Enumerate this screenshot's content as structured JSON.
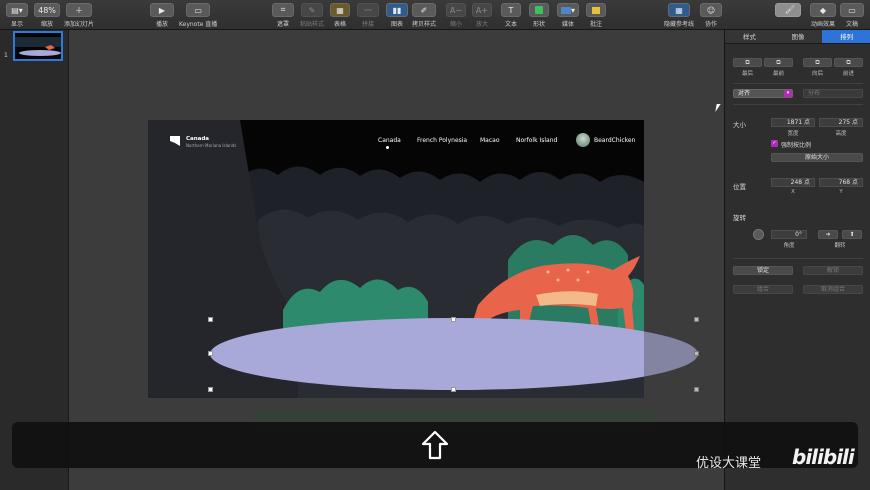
{
  "toolbar": {
    "view": {
      "label": "显示"
    },
    "zoom": {
      "label": "缩放",
      "value": "48%"
    },
    "add_slide": {
      "label": "添加幻灯片"
    },
    "play": {
      "label": "播放"
    },
    "keynote_live": {
      "label": "Keynote 直播"
    },
    "mask": {
      "label": "遮罩"
    },
    "cursor_style": {
      "label": "粘贴样式"
    },
    "table": {
      "label": "表格"
    },
    "chart_like": {
      "label": "拼接"
    },
    "chart": {
      "label": "图表"
    },
    "copy_style": {
      "label": "拷贝样式"
    },
    "shrink": {
      "label": "缩小"
    },
    "enlarge": {
      "label": "放大"
    },
    "text": {
      "label": "文本"
    },
    "shape": {
      "label": "形状"
    },
    "media": {
      "label": "媒体"
    },
    "comment": {
      "label": "批注"
    },
    "guides": {
      "label": "隐藏参考线"
    },
    "collaborate": {
      "label": "协作"
    },
    "format": {
      "label": "格式"
    },
    "animate": {
      "label": "动画效果"
    },
    "document": {
      "label": "文稿"
    }
  },
  "navigator": {
    "slide_number": "1"
  },
  "slide": {
    "logo_title": "Canada",
    "logo_subtitle": "Northern Mariana Islands",
    "nav": [
      "Canada",
      "French Polynesia",
      "Macao",
      "Norfolk Island"
    ],
    "user": "BeardChicken",
    "colors": {
      "sky": "#050506",
      "forest": "#1e1f24",
      "deer": "#e8644a",
      "deer_light": "#f3b98a",
      "lake": "#a9a9d9",
      "bush": "#2d8a6d"
    }
  },
  "panel": {
    "tabs": [
      "样式",
      "图像",
      "排列"
    ],
    "arrange": {
      "back": "最后",
      "front": "最前",
      "backward": "向后",
      "forward": "前进"
    },
    "align_label": "对齐",
    "distribute_label": "分布",
    "size": {
      "label": "大小",
      "width": "1871 点",
      "height": "275 点",
      "width_label": "宽度",
      "height_label": "高度",
      "constrain": "强制按比例",
      "original": "原始大小"
    },
    "position": {
      "label": "位置",
      "x": "248 点",
      "y": "768 点",
      "x_label": "X",
      "y_label": "Y"
    },
    "rotate": {
      "label": "旋转",
      "angle": "0°",
      "angle_label": "角度",
      "flip_label": "翻转"
    },
    "lock": "锁定",
    "unlock": "解锁",
    "group": "组合",
    "ungroup": "取消组合"
  },
  "watermark": {
    "text": "优设大课堂",
    "brand": "bilibili"
  }
}
